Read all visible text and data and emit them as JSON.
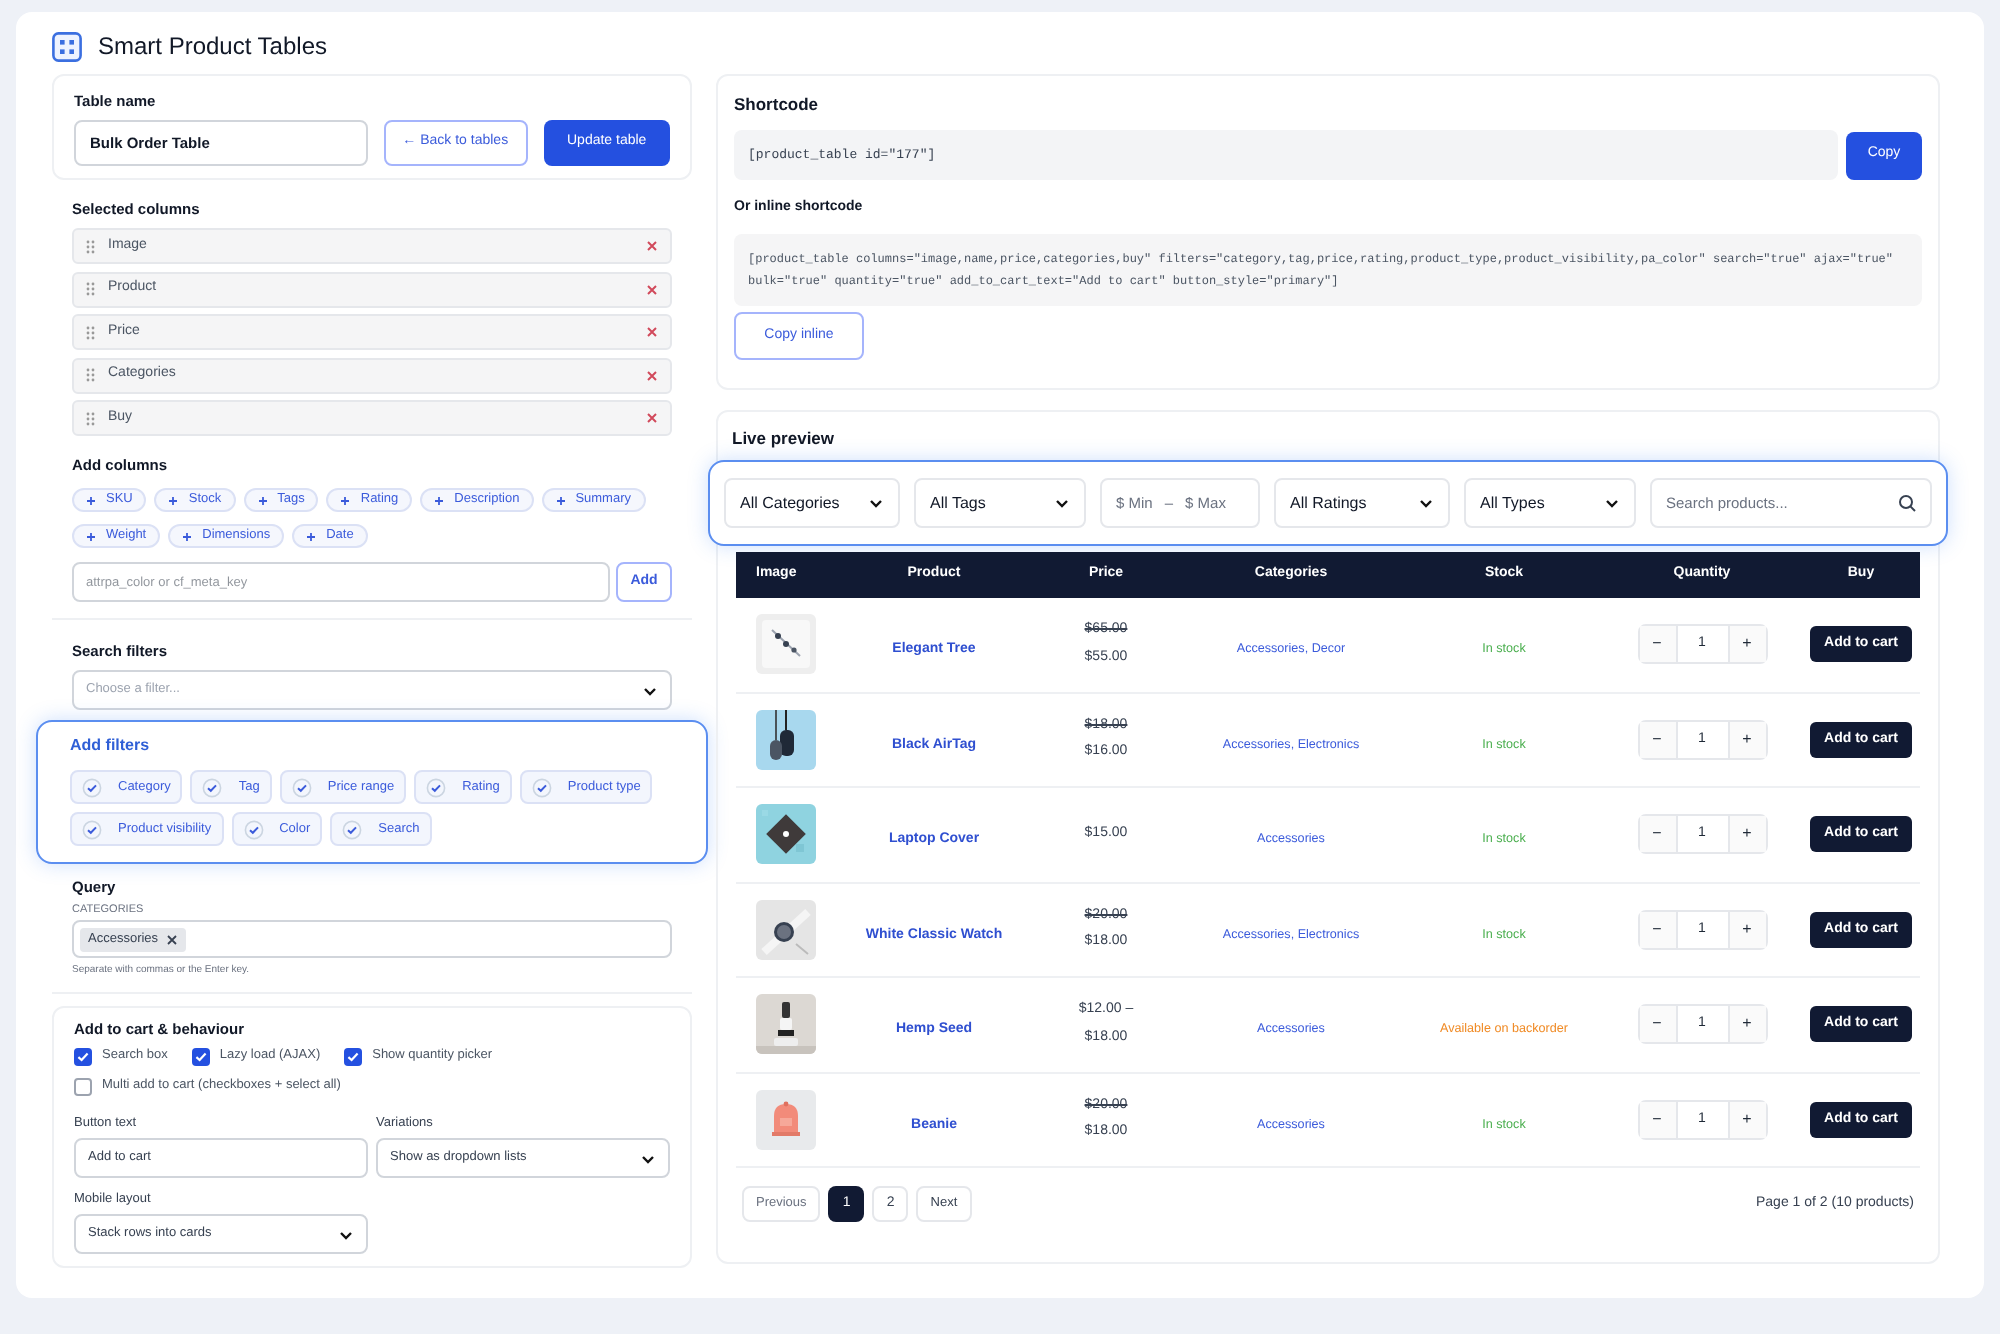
{
  "app": {
    "title": "Smart Product Tables"
  },
  "table_name": {
    "label": "Table name",
    "value": "Bulk Order Table",
    "back_button": "← Back to tables",
    "update_button": "Update table"
  },
  "selected_columns": {
    "label": "Selected columns",
    "items": [
      "Image",
      "Product",
      "Price",
      "Categories",
      "Buy"
    ]
  },
  "add_columns": {
    "label": "Add columns",
    "chips": [
      "SKU",
      "Stock",
      "Tags",
      "Rating",
      "Description",
      "Summary",
      "Weight",
      "Dimensions",
      "Date"
    ],
    "placeholder": "attrpa_color or cf_meta_key",
    "add_button": "Add"
  },
  "search_filters": {
    "label": "Search filters",
    "placeholder": "Choose a filter..."
  },
  "add_filters": {
    "label": "Add filters",
    "items": [
      {
        "label": "Category",
        "checked": true
      },
      {
        "label": "Tag",
        "checked": true
      },
      {
        "label": "Price range",
        "checked": true
      },
      {
        "label": "Rating",
        "checked": true
      },
      {
        "label": "Product type",
        "checked": true
      },
      {
        "label": "Product visibility",
        "checked": true
      },
      {
        "label": "Color",
        "checked": true
      },
      {
        "label": "Search",
        "checked": true
      }
    ]
  },
  "query": {
    "label": "Query",
    "sublabel": "CATEGORIES",
    "tags": [
      "Accessories"
    ],
    "hint": "Separate with commas or the Enter key."
  },
  "behaviour": {
    "label": "Add to cart & behaviour",
    "checkboxes": [
      {
        "label": "Search box",
        "checked": true
      },
      {
        "label": "Lazy load (AJAX)",
        "checked": true
      },
      {
        "label": "Show quantity picker",
        "checked": true
      },
      {
        "label": "Multi add to cart (checkboxes + select all)",
        "checked": false
      }
    ],
    "button_text": {
      "label": "Button text",
      "value": "Add to cart"
    },
    "variations": {
      "label": "Variations",
      "value": "Show as dropdown lists"
    },
    "mobile_layout": {
      "label": "Mobile layout",
      "value": "Stack rows into cards"
    }
  },
  "shortcode": {
    "title": "Shortcode",
    "code": "[product_table id=\"177\"]",
    "copy_button": "Copy",
    "inline_title": "Or inline shortcode",
    "inline_code": "[product_table columns=\"image,name,price,categories,buy\" filters=\"category,tag,price,rating,product_type,product_visibility,pa_color\" search=\"true\" ajax=\"true\" bulk=\"true\" quantity=\"true\" add_to_cart_text=\"Add to cart\" button_style=\"primary\"]",
    "copy_inline_button": "Copy inline"
  },
  "preview": {
    "title": "Live preview",
    "filters": [
      {
        "kind": "select",
        "label": "All Categories"
      },
      {
        "kind": "select",
        "label": "All Tags"
      },
      {
        "kind": "range",
        "min": "$ Min",
        "separator": "–",
        "max": "$ Max"
      },
      {
        "kind": "select",
        "label": "All Ratings"
      },
      {
        "kind": "select",
        "label": "All Types"
      },
      {
        "kind": "search",
        "placeholder": "Search products..."
      }
    ],
    "columns": [
      "Image",
      "Product",
      "Price",
      "Categories",
      "Stock",
      "Quantity",
      "Buy"
    ],
    "rows": [
      {
        "name": "Elegant Tree",
        "old_price": "$65.00",
        "price": "$55.00",
        "categories": "Accessories, Decor",
        "stock": "In stock",
        "color": "#4caf50",
        "quantity": "1",
        "button": "Add to cart",
        "minus": "−",
        "plus": "+"
      },
      {
        "name": "Black AirTag",
        "old_price": "$18.00",
        "price": "$16.00",
        "categories": "Accessories, Electronics",
        "stock": "In stock",
        "color": "#4caf50",
        "quantity": "1",
        "button": "Add to cart",
        "minus": "−",
        "plus": "+"
      },
      {
        "name": "Laptop Cover",
        "price": "$15.00",
        "categories": "Accessories",
        "stock": "In stock",
        "color": "#4caf50",
        "quantity": "1",
        "button": "Add to cart",
        "minus": "−",
        "plus": "+"
      },
      {
        "name": "White Classic Watch",
        "old_price": "$20.00",
        "price": "$18.00",
        "categories": "Accessories, Electronics",
        "stock": "In stock",
        "color": "#4caf50",
        "quantity": "1",
        "button": "Add to cart",
        "minus": "−",
        "plus": "+"
      },
      {
        "name": "Hemp Seed",
        "price": "$12.00 –",
        "price_2": "$18.00",
        "categories": "Accessories",
        "stock": "Available on backorder",
        "color": "#f08a24",
        "quantity": "1",
        "button": "Add to cart",
        "minus": "−",
        "plus": "+"
      },
      {
        "name": "Beanie",
        "old_price": "$20.00",
        "price": "$18.00",
        "categories": "Accessories",
        "stock": "In stock",
        "color": "#4caf50",
        "quantity": "1",
        "button": "Add to cart",
        "minus": "−",
        "plus": "+"
      }
    ],
    "pagination": {
      "previous": "Previous",
      "pages": [
        {
          "label": "1",
          "selected": true
        },
        {
          "label": "2",
          "selected": false
        }
      ],
      "next": "Next",
      "summary": "Page 1 of 2 (10 products)"
    }
  }
}
